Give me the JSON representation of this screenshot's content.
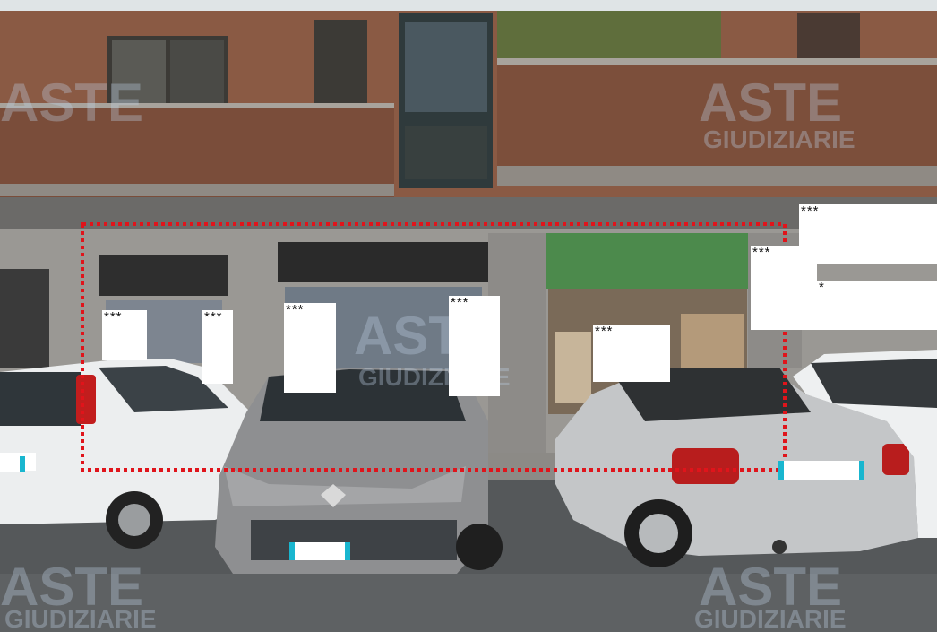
{
  "image": {
    "subject": "street-level facade of a brick apartment building with a ground-floor commercial unit outlined by a red dotted rectangle and parked cars in front",
    "colors": {
      "sky": "#dfe4e6",
      "brick": "#8a5a44",
      "brick_dark": "#6e4434",
      "concrete": "#9a9894",
      "asphalt": "#55585a",
      "highlight_line": "#e0141b",
      "plate_band": "#19b6cf",
      "watermark": "#bfcde1"
    }
  },
  "redactions": {
    "mark": "***",
    "single_mark": "*",
    "blocks": [
      {
        "text": "***"
      },
      {
        "text": "***"
      },
      {
        "text": "***"
      },
      {
        "text": "***"
      },
      {
        "text": "***"
      },
      {
        "text": "***"
      },
      {
        "text": "***"
      },
      {
        "text": "*"
      }
    ]
  },
  "watermark": {
    "line1": "ASTE",
    "line2": "GIUDIZIARIE"
  }
}
